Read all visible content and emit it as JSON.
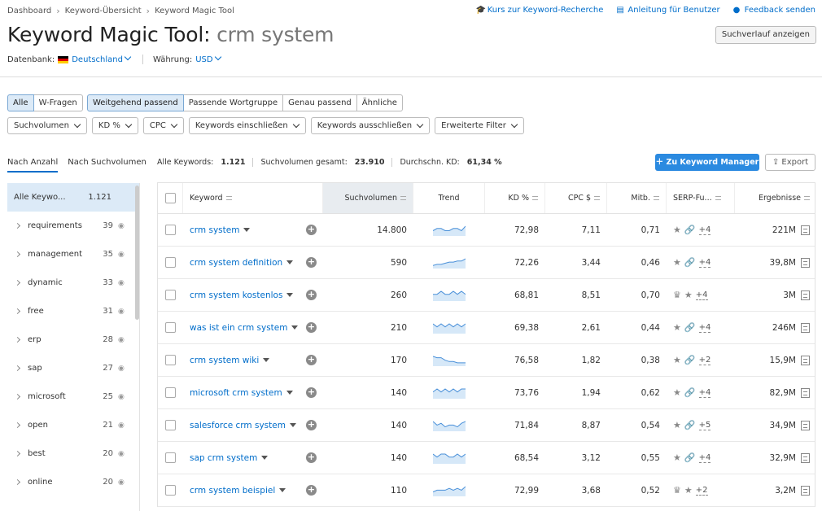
{
  "breadcrumbs": [
    "Dashboard",
    "Keyword-Übersicht",
    "Keyword Magic Tool"
  ],
  "top_links": {
    "course": "Kurs zur Keyword-Recherche",
    "guide": "Anleitung für Benutzer",
    "feedback": "Feedback senden"
  },
  "title": {
    "main": "Keyword Magic Tool:",
    "query": "crm system"
  },
  "history_button": "Suchverlauf anzeigen",
  "database": {
    "label": "Datenbank:",
    "value": "Deutschland",
    "currency_label": "Währung:",
    "currency": "USD"
  },
  "match_tabs": {
    "group1": [
      "Alle",
      "W-Fragen"
    ],
    "group2": [
      "Weitgehend passend",
      "Passende Wortgruppe",
      "Genau passend",
      "Ähnliche"
    ]
  },
  "filters": [
    "Suchvolumen",
    "KD %",
    "CPC",
    "Keywords einschließen",
    "Keywords ausschließen",
    "Erweiterte Filter"
  ],
  "side_tabs": [
    "Nach Anzahl",
    "Nach Suchvolumen"
  ],
  "stats": {
    "all_label": "Alle Keywords:",
    "all_value": "1.121",
    "vol_label": "Suchvolumen gesamt:",
    "vol_value": "23.910",
    "kd_label": "Durchschn. KD:",
    "kd_value": "61,34 %"
  },
  "add_button": "Zu Keyword Manager",
  "export_button": "Export",
  "sidebar": {
    "all": {
      "label": "Alle Keywo...",
      "count": "1.121"
    },
    "groups": [
      {
        "name": "requirements",
        "count": "39"
      },
      {
        "name": "management",
        "count": "35"
      },
      {
        "name": "dynamic",
        "count": "33"
      },
      {
        "name": "free",
        "count": "31"
      },
      {
        "name": "erp",
        "count": "28"
      },
      {
        "name": "sap",
        "count": "27"
      },
      {
        "name": "microsoft",
        "count": "25"
      },
      {
        "name": "open",
        "count": "21"
      },
      {
        "name": "best",
        "count": "20"
      },
      {
        "name": "online",
        "count": "20"
      }
    ]
  },
  "table": {
    "headers": [
      "Keyword",
      "Suchvolumen",
      "Trend",
      "KD %",
      "CPC $",
      "Mitb.",
      "SERP-Fu...",
      "Ergebnisse"
    ],
    "rows": [
      {
        "keyword": "crm system",
        "volume": "14.800",
        "kd": "72,98",
        "cpc": "7,11",
        "comp": "0,71",
        "serp": "+4",
        "results": "221M",
        "crown": false,
        "link": true,
        "trend": [
          6,
          7,
          7,
          6,
          6,
          7,
          7,
          6,
          8
        ]
      },
      {
        "keyword": "crm system definition",
        "volume": "590",
        "kd": "72,26",
        "cpc": "3,44",
        "comp": "0,46",
        "serp": "+4",
        "results": "39,8M",
        "crown": false,
        "link": true,
        "trend": [
          3,
          4,
          4,
          5,
          6,
          6,
          7,
          7,
          9
        ]
      },
      {
        "keyword": "crm system kostenlos",
        "volume": "260",
        "kd": "68,81",
        "cpc": "8,51",
        "comp": "0,70",
        "serp": "+4",
        "results": "3M",
        "crown": true,
        "link": false,
        "trend": [
          6,
          6,
          7,
          6,
          6,
          7,
          6,
          7,
          6
        ]
      },
      {
        "keyword": "was ist ein crm system",
        "volume": "210",
        "kd": "69,38",
        "cpc": "2,61",
        "comp": "0,44",
        "serp": "+4",
        "results": "246M",
        "crown": false,
        "link": true,
        "trend": [
          7,
          6,
          7,
          6,
          7,
          6,
          7,
          6,
          7
        ]
      },
      {
        "keyword": "crm system wiki",
        "volume": "170",
        "kd": "76,58",
        "cpc": "1,82",
        "comp": "0,38",
        "serp": "+2",
        "results": "15,9M",
        "crown": false,
        "link": true,
        "trend": [
          8,
          7,
          7,
          5,
          4,
          4,
          3,
          3,
          3
        ]
      },
      {
        "keyword": "microsoft crm system",
        "volume": "140",
        "kd": "73,76",
        "cpc": "1,94",
        "comp": "0,62",
        "serp": "+4",
        "results": "82,9M",
        "crown": false,
        "link": true,
        "trend": [
          6,
          7,
          6,
          7,
          6,
          7,
          6,
          7,
          7
        ]
      },
      {
        "keyword": "salesforce crm system",
        "volume": "140",
        "kd": "71,84",
        "cpc": "8,87",
        "comp": "0,54",
        "serp": "+5",
        "results": "34,9M",
        "crown": false,
        "link": true,
        "trend": [
          7,
          5,
          6,
          4,
          5,
          5,
          4,
          6,
          7
        ]
      },
      {
        "keyword": "sap crm system",
        "volume": "140",
        "kd": "68,54",
        "cpc": "3,12",
        "comp": "0,55",
        "serp": "+4",
        "results": "32,9M",
        "crown": false,
        "link": true,
        "trend": [
          7,
          6,
          7,
          7,
          6,
          6,
          7,
          6,
          7
        ]
      },
      {
        "keyword": "crm system beispiel",
        "volume": "110",
        "kd": "72,99",
        "cpc": "3,68",
        "comp": "0,52",
        "serp": "+2",
        "results": "3,2M",
        "crown": true,
        "link": false,
        "trend": [
          5,
          6,
          6,
          6,
          7,
          6,
          7,
          6,
          8
        ]
      }
    ]
  }
}
